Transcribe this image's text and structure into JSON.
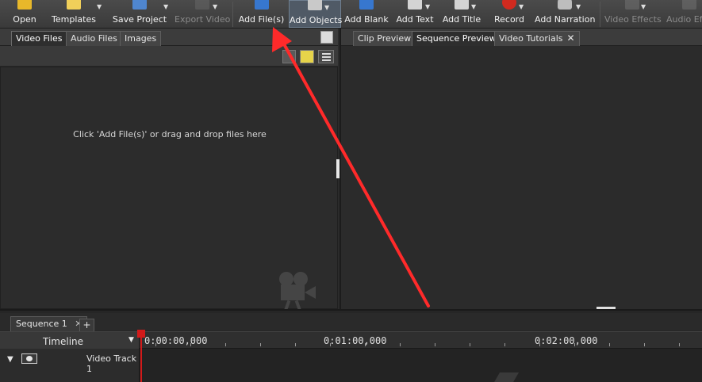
{
  "toolbar": {
    "buttons": [
      {
        "label": "Open",
        "icon": "open-folder-icon",
        "color": "#f0c419",
        "enabled": true
      },
      {
        "label": "Templates",
        "icon": "templates-icon",
        "color": "#f3d36c",
        "enabled": true
      },
      {
        "label": "Save Project",
        "icon": "save-disk-icon",
        "color": "#5a8fd6",
        "enabled": true
      },
      {
        "label": "Export Video",
        "icon": "export-film-icon",
        "color": "#777777",
        "enabled": false
      },
      {
        "label": "Add File(s)",
        "icon": "add-files-icon",
        "color": "#3b7ed8",
        "enabled": true
      },
      {
        "label": "Add Objects",
        "icon": "add-objects-icon",
        "color": "#cfcfcf",
        "enabled": true
      },
      {
        "label": "Add Blank",
        "icon": "add-blank-icon",
        "color": "#3b7ed8",
        "enabled": true
      },
      {
        "label": "Add Text",
        "icon": "add-text-icon",
        "color": "#dcdcdc",
        "enabled": true
      },
      {
        "label": "Add Title",
        "icon": "add-title-icon",
        "color": "#dcdcdc",
        "enabled": true
      },
      {
        "label": "Record",
        "icon": "record-icon",
        "color": "#d9261c",
        "enabled": true
      },
      {
        "label": "Add Narration",
        "icon": "microphone-icon",
        "color": "#cfcfcf",
        "enabled": true
      },
      {
        "label": "Video Effects",
        "icon": "video-fx-icon",
        "color": "#888888",
        "enabled": false
      },
      {
        "label": "Audio Effects",
        "icon": "audio-fx-icon",
        "color": "#888888",
        "enabled": false
      }
    ]
  },
  "media_panel": {
    "tabs": [
      "Video Files",
      "Audio Files",
      "Images"
    ],
    "selected_tab": "Video Files",
    "drop_hint": "Click 'Add File(s)' or drag and drop files here"
  },
  "preview_panel": {
    "tabs": [
      "Clip Preview",
      "Sequence Preview",
      "Video Tutorials"
    ],
    "selected_tab": "Sequence Preview"
  },
  "timeline": {
    "sequence_tab": "Sequence 1",
    "add_tab": "+",
    "label": "Timeline",
    "time_marks": [
      "0:00:00,000",
      "0:01:00,000",
      "0:02:00,000"
    ],
    "track_name": "Video Track 1",
    "playhead_time": "0:00:00,000"
  },
  "annotation": {
    "color": "#ff2a2a",
    "target": "Add File(s)"
  }
}
